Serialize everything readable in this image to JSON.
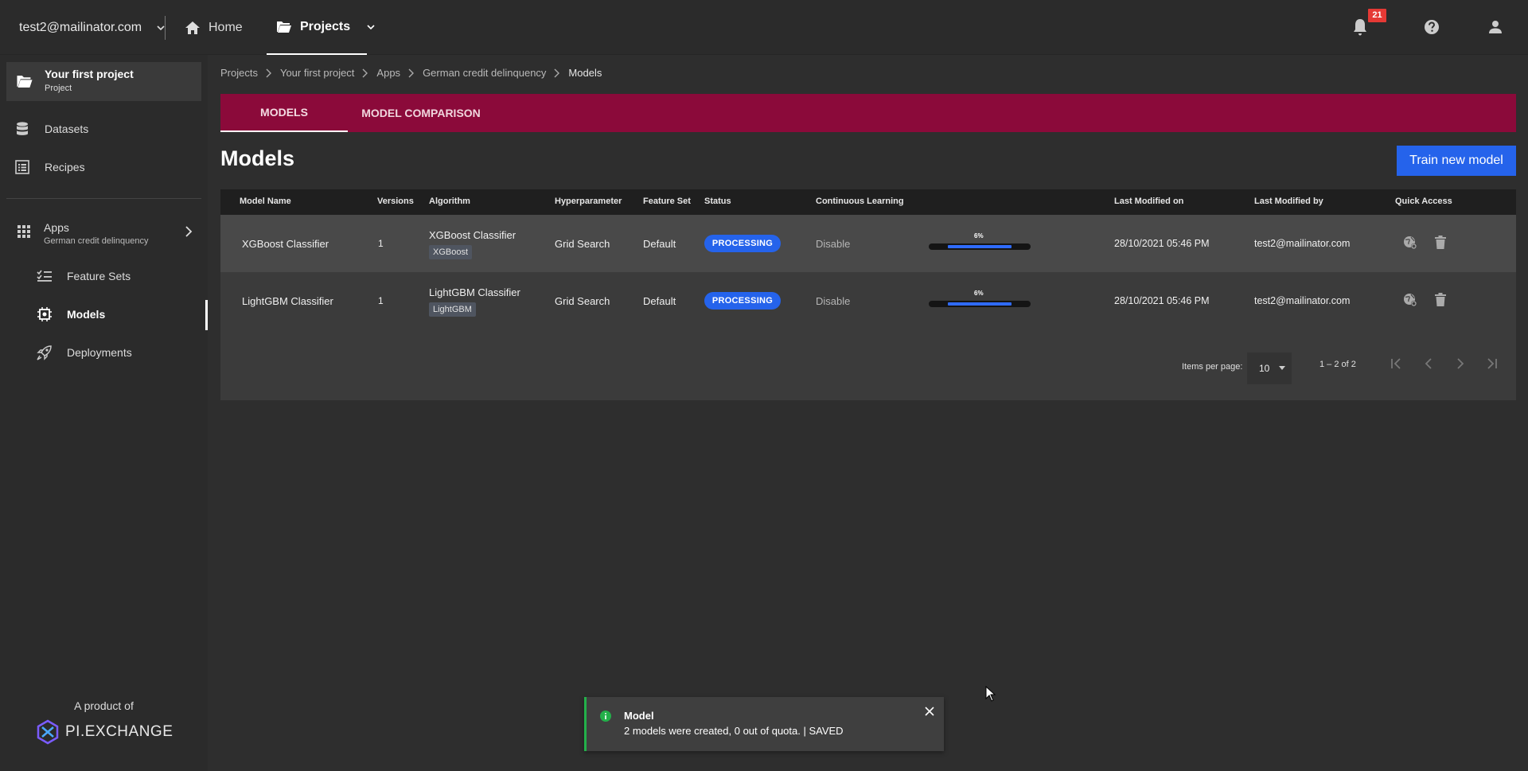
{
  "topbar": {
    "user_email": "test2@mailinator.com",
    "home_label": "Home",
    "projects_label": "Projects",
    "notification_count": "21"
  },
  "sidebar": {
    "project_title": "Your first project",
    "project_subtitle": "Project",
    "items": [
      {
        "label": "Datasets",
        "icon": "database-icon"
      },
      {
        "label": "Recipes",
        "icon": "list-icon"
      }
    ],
    "apps_title": "Apps",
    "apps_subtitle": "German credit delinquency",
    "sub_items": [
      {
        "label": "Feature Sets",
        "icon": "checklist-icon"
      },
      {
        "label": "Models",
        "icon": "chip-icon"
      },
      {
        "label": "Deployments",
        "icon": "rocket-icon"
      }
    ],
    "footer_text": "A product of",
    "logo_text": "PI.EXCHANGE"
  },
  "breadcrumb": [
    "Projects",
    "Your first project",
    "Apps",
    "German credit delinquency",
    "Models"
  ],
  "tabs": [
    {
      "label": "MODELS",
      "active": true
    },
    {
      "label": "MODEL COMPARISON",
      "active": false
    }
  ],
  "page_title": "Models",
  "train_button": "Train new model",
  "table": {
    "headers": [
      "Model Name",
      "Versions",
      "Algorithm",
      "Hyperparameter",
      "Feature Set",
      "Status",
      "Continuous Learning",
      "Last Modified on",
      "Last Modified by",
      "Quick Access"
    ],
    "rows": [
      {
        "name": "XGBoost Classifier",
        "versions": "1",
        "algorithm": "XGBoost Classifier",
        "algorithm_tag": "XGBoost",
        "hyperparameter": "Grid Search",
        "feature_set": "Default",
        "status": "PROCESSING",
        "continuous_learning": "Disable",
        "progress_label": "6%",
        "progress": 0.06,
        "last_modified_on": "28/10/2021 05:46 PM",
        "last_modified_by": "test2@mailinator.com"
      },
      {
        "name": "LightGBM Classifier",
        "versions": "1",
        "algorithm": "LightGBM Classifier",
        "algorithm_tag": "LightGBM",
        "hyperparameter": "Grid Search",
        "feature_set": "Default",
        "status": "PROCESSING",
        "continuous_learning": "Disable",
        "progress_label": "6%",
        "progress": 0.06,
        "last_modified_on": "28/10/2021 05:46 PM",
        "last_modified_by": "test2@mailinator.com"
      }
    ]
  },
  "pagination": {
    "items_per_page_label": "Items per page:",
    "items_per_page": "10",
    "range": "1 – 2 of 2"
  },
  "toast": {
    "title": "Model",
    "message": "2 models were created, 0 out of quota. | SAVED"
  },
  "colors": {
    "accent_tab_bar": "#8b0a3a",
    "primary_button": "#2563eb",
    "success": "#23b04a",
    "badge": "#e53935"
  }
}
